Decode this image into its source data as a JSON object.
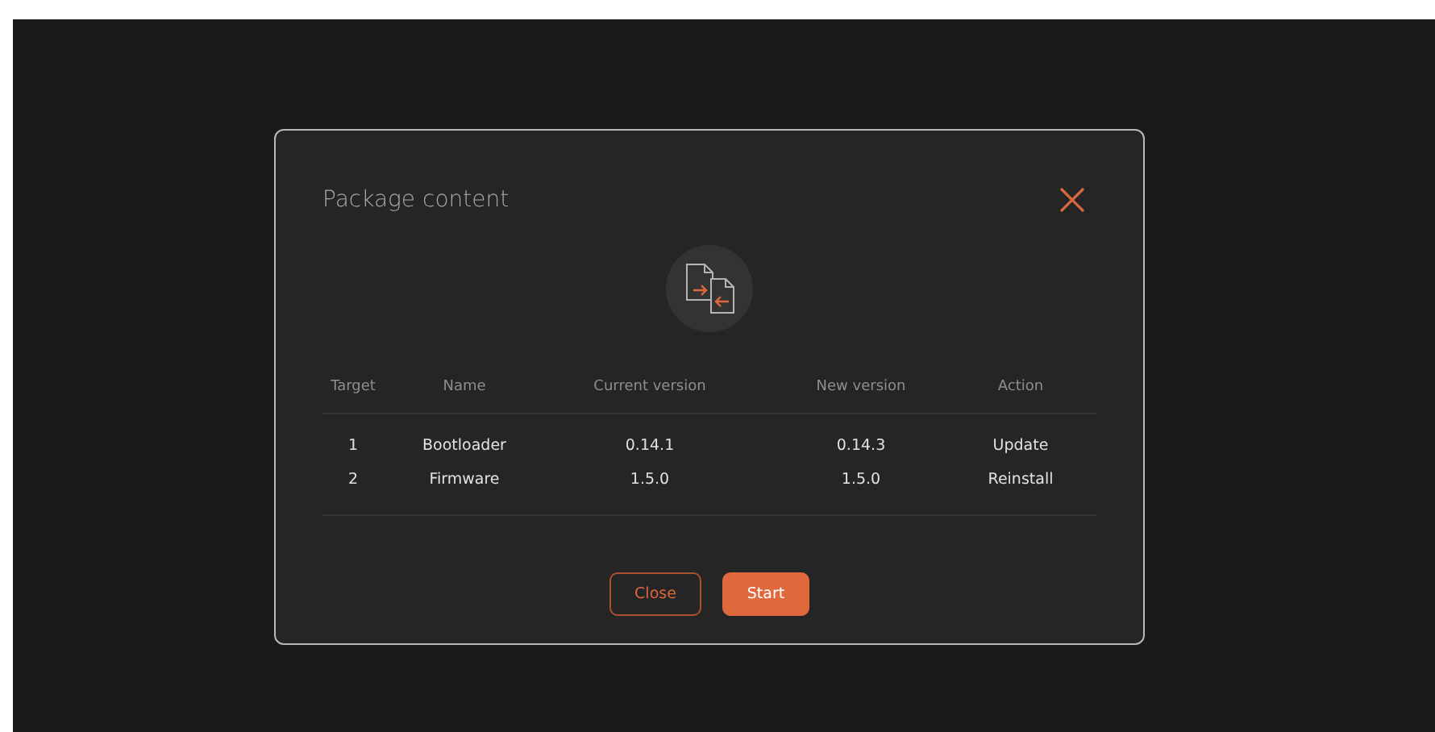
{
  "dialog": {
    "title": "Package content",
    "table": {
      "columns": [
        "Target",
        "Name",
        "Current version",
        "New version",
        "Action"
      ],
      "rows": [
        {
          "target": "1",
          "name": "Bootloader",
          "current_version": "0.14.1",
          "new_version": "0.14.3",
          "action": "Update"
        },
        {
          "target": "2",
          "name": "Firmware",
          "current_version": "1.5.0",
          "new_version": "1.5.0",
          "action": "Reinstall"
        }
      ]
    },
    "buttons": [
      {
        "label": "Close",
        "kind": "outline"
      },
      {
        "label": "Start",
        "kind": "primary"
      }
    ]
  }
}
